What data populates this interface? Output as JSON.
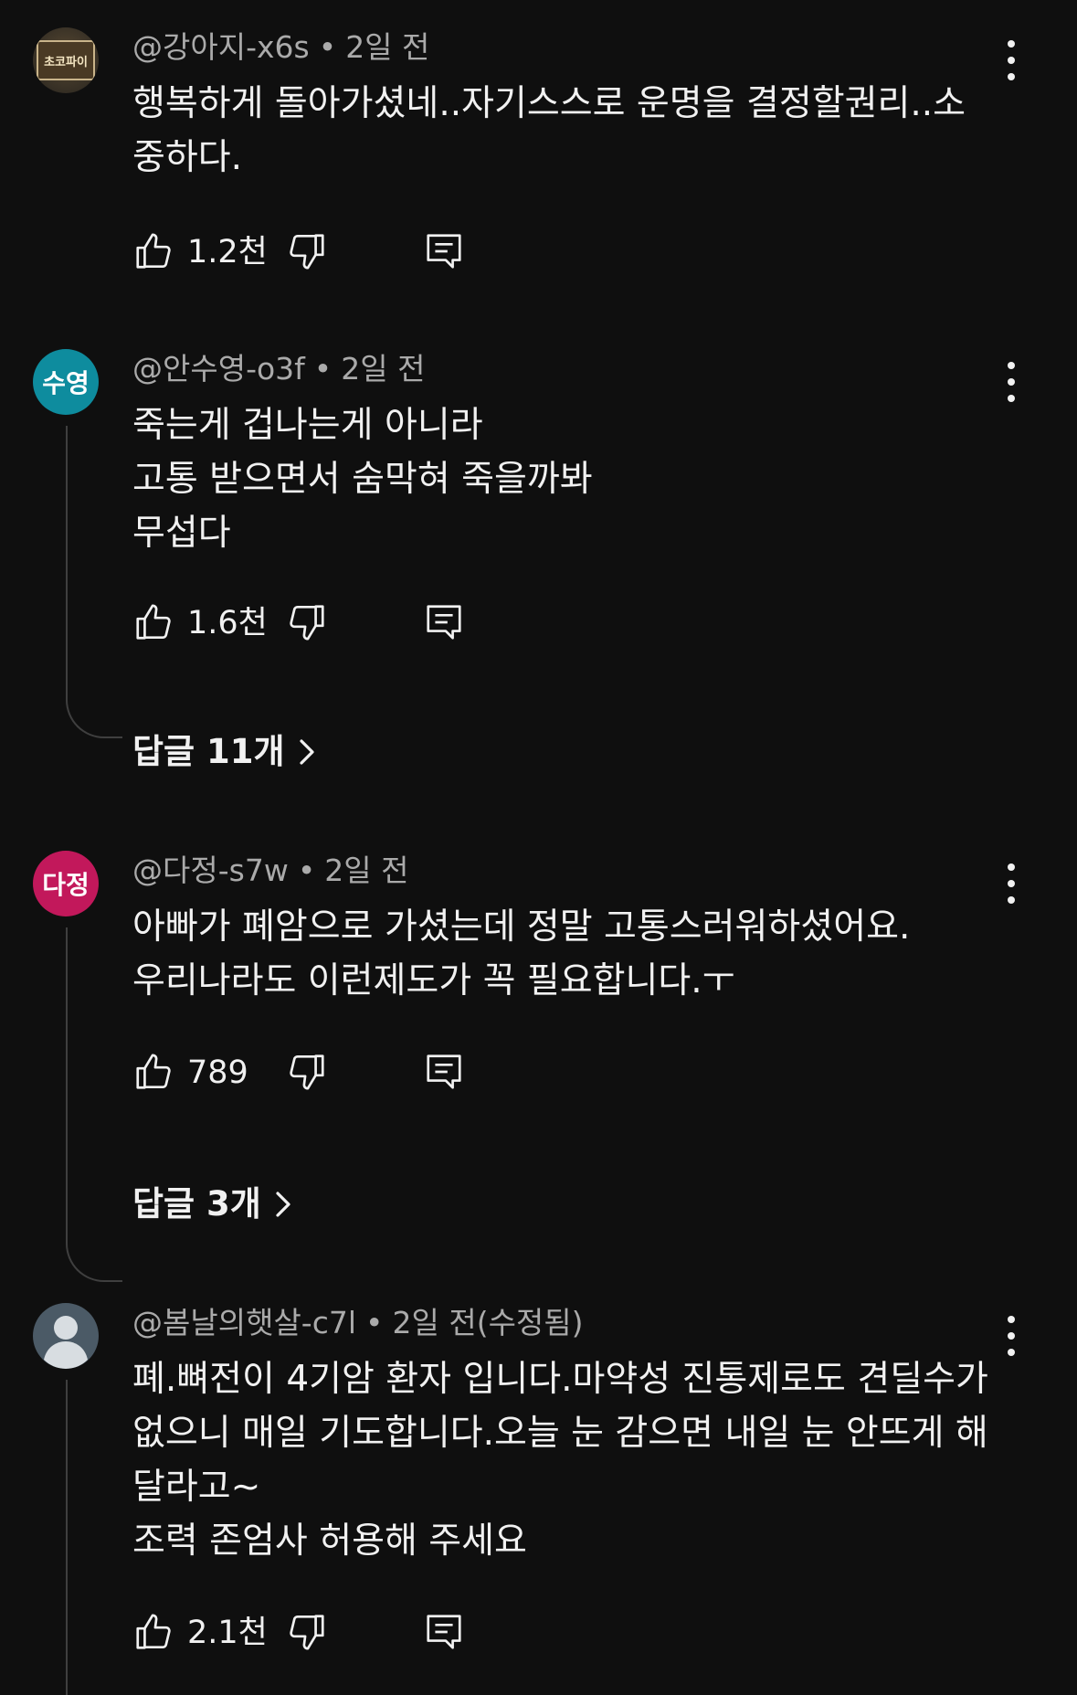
{
  "comments": [
    {
      "handle": "@강아지-x6s",
      "time": "2일 전",
      "text": "행복하게 돌아가셨네..자기스스로 운명을 결정할권리..소\n중하다.",
      "likes": "1.2천",
      "avatar": {
        "type": "image",
        "label": "초코파이",
        "color": "#4a3a24"
      }
    },
    {
      "handle": "@안수영-o3f",
      "time": "2일 전",
      "text": "죽는게 겁나는게 아니라\n고통 받으면서 숨막혀 죽을까봐\n무섭다",
      "likes": "1.6천",
      "replies": "답글 11개",
      "avatar": {
        "type": "initials",
        "label": "수영",
        "color": "#0e8c9e"
      }
    },
    {
      "handle": "@다정-s7w",
      "time": "2일 전",
      "text": "아빠가 폐암으로 가셨는데 정말 고통스러워하셨어요.\n우리나라도 이런제도가 꼭 필요합니다.ㅜ",
      "likes": "789",
      "replies": "답글 3개",
      "avatar": {
        "type": "initials",
        "label": "다정",
        "color": "#c2185b"
      }
    },
    {
      "handle": "@봄날의햇살-c7l",
      "time": "2일 전(수정됨)",
      "text": "폐.뼈전이 4기암 환자 입니다.마약성 진통제로도 견딜수가\n없으니 매일 기도합니다.오늘 눈 감으면 내일  눈 안뜨게 해\n달라고~\n조력 존엄사 허용해 주세요",
      "likes": "2.1천",
      "avatar": {
        "type": "default",
        "color": "#4b5a66"
      }
    }
  ],
  "icons": {
    "like": "thumb-up-icon",
    "dislike": "thumb-down-icon",
    "reply": "comment-reply-icon",
    "more": "more-vertical-icon",
    "chevron": "chevron-right-icon"
  },
  "colors": {
    "background": "#0f0f0f",
    "text": "#f1f1f1",
    "meta": "#aaaaaa",
    "thread_line": "#3f3f3f"
  }
}
